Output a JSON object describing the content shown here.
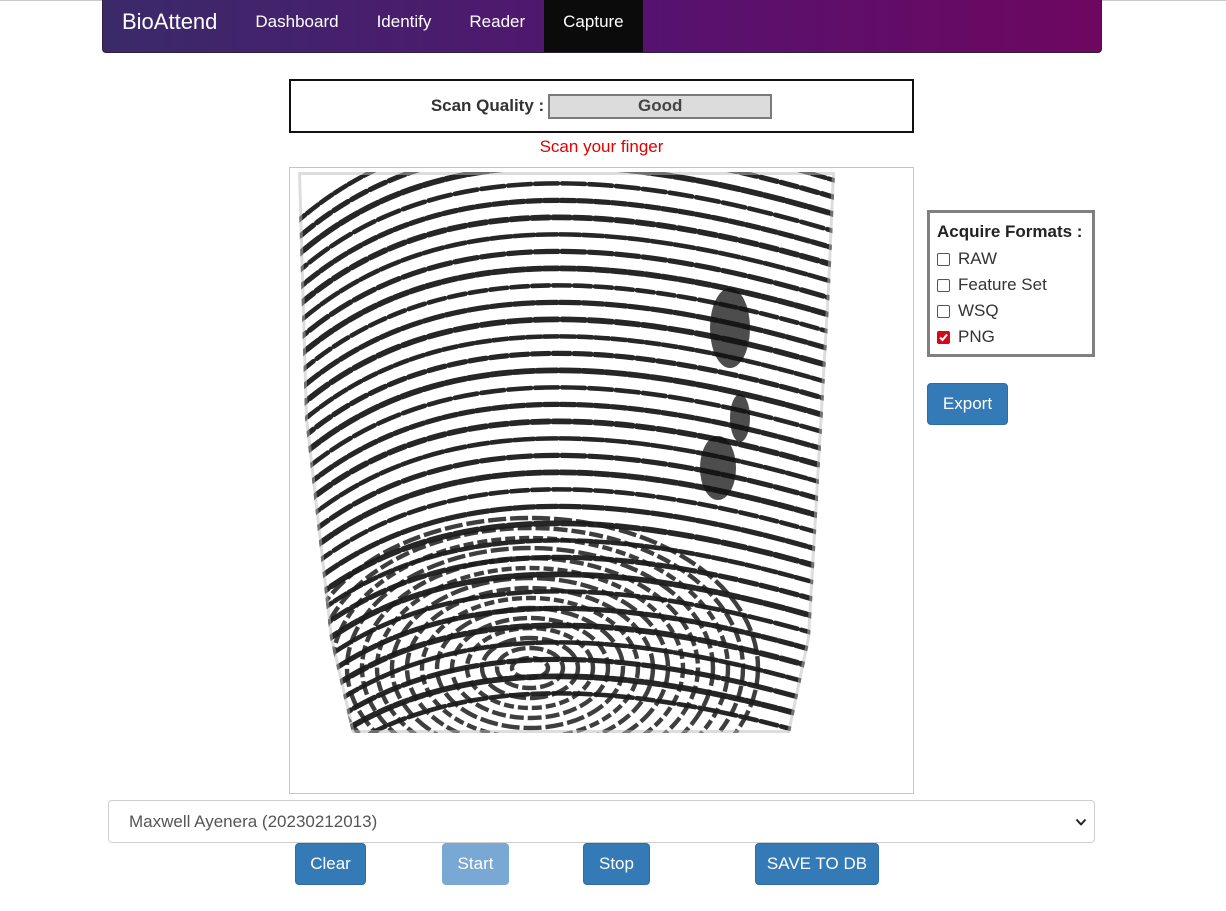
{
  "nav": {
    "brand": "BioAttend",
    "links": [
      "Dashboard",
      "Identify",
      "Reader",
      "Capture"
    ],
    "active": "Capture"
  },
  "scan": {
    "quality_label": "Scan Quality :",
    "quality_value": "Good",
    "message": "Scan your finger"
  },
  "formats": {
    "title": "Acquire Formats :",
    "options": [
      {
        "label": "RAW",
        "checked": false
      },
      {
        "label": "Feature Set",
        "checked": false
      },
      {
        "label": "WSQ",
        "checked": false
      },
      {
        "label": "PNG",
        "checked": true
      }
    ]
  },
  "buttons": {
    "export": "Export",
    "clear": "Clear",
    "start": "Start",
    "stop": "Stop",
    "save": "SAVE TO DB"
  },
  "student_select": {
    "value": "Maxwell Ayenera (20230212013)"
  },
  "colors": {
    "nav_start": "#3a2a6a",
    "nav_end": "#6e0760",
    "primary_button": "#337ab7",
    "message_red": "#e00000",
    "checked_red": "#d4081a"
  },
  "icons": {
    "fingerprint": "fingerprint-image",
    "select": "chevron-down-icon",
    "checkmark": "checkmark-icon"
  }
}
